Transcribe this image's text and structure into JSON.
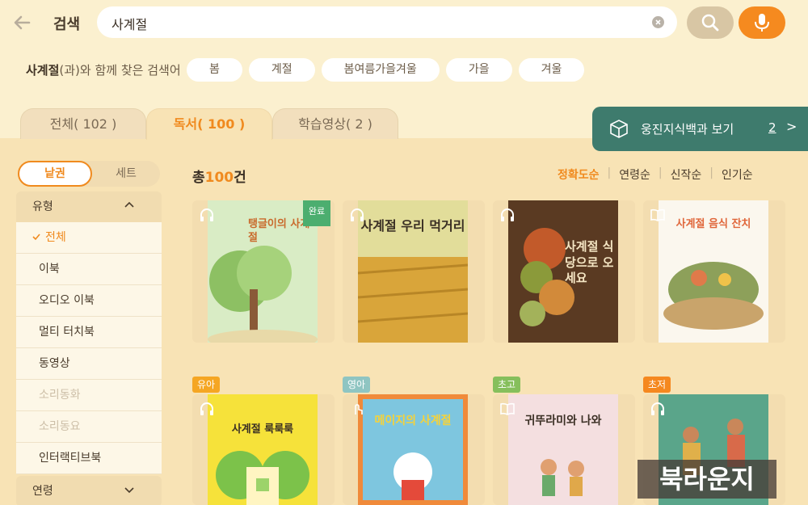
{
  "header": {
    "title": "검색",
    "search_value": "사계절"
  },
  "related": {
    "keyword": "사계절",
    "suffix": "(과)와 함께 찾은 검색어",
    "chips": [
      "봄",
      "계절",
      "봄여름가을겨울",
      "가을",
      "겨울"
    ]
  },
  "tabs": [
    {
      "label": "전체( 102 )"
    },
    {
      "label": "독서( 100 )"
    },
    {
      "label": "학습영상( 2 )"
    }
  ],
  "encyclopedia": {
    "label": "웅진지식백과 보기",
    "count": "2",
    "arrow": ">"
  },
  "toggle": {
    "on": "낱권",
    "off": "세트"
  },
  "filters": {
    "type_header": "유형",
    "type_items": [
      "전체",
      "이북",
      "오디오 이북",
      "멀티 터치북",
      "동영상",
      "소리동화",
      "소리동요",
      "인터랙티브북"
    ],
    "age_header": "연령"
  },
  "results": {
    "prefix": "총",
    "count": "100",
    "suffix": "건"
  },
  "sorts": [
    "정확도순",
    "연령순",
    "신작순",
    "인기순"
  ],
  "books_row1": [
    {
      "title": "탱글이의 사계절",
      "icon": "headphones-icon",
      "badge": "완료",
      "color": "#d9ecc5"
    },
    {
      "title": "사계절 우리 먹거리",
      "icon": "headphones-icon",
      "badge": "",
      "color": "#c7c46a"
    },
    {
      "title": "사계절 식당으로 오세요",
      "icon": "headphones-icon",
      "badge": "",
      "color": "#5a3a22"
    },
    {
      "title": "사계절 음식 잔치",
      "icon": "book-icon",
      "badge": "",
      "color": "#fbf7ee"
    }
  ],
  "books_row2": [
    {
      "title": "사계절 룩룩룩",
      "icon": "headphones-icon",
      "level": "유아",
      "level_color": "#f5a623",
      "color": "#f6e23a"
    },
    {
      "title": "메이지의 사계절",
      "icon": "touch-icon",
      "level": "영아",
      "level_color": "#8fc5c2",
      "color": "#7ec6df"
    },
    {
      "title": "귀뚜라미와 나와",
      "icon": "book-icon",
      "level": "초고",
      "level_color": "#86bf5c",
      "color": "#f4dfe0"
    },
    {
      "title": "",
      "icon": "headphones-icon",
      "level": "초저",
      "level_color": "#f5881f",
      "color": "#5aa58a"
    }
  ],
  "watermark": "북라운지"
}
